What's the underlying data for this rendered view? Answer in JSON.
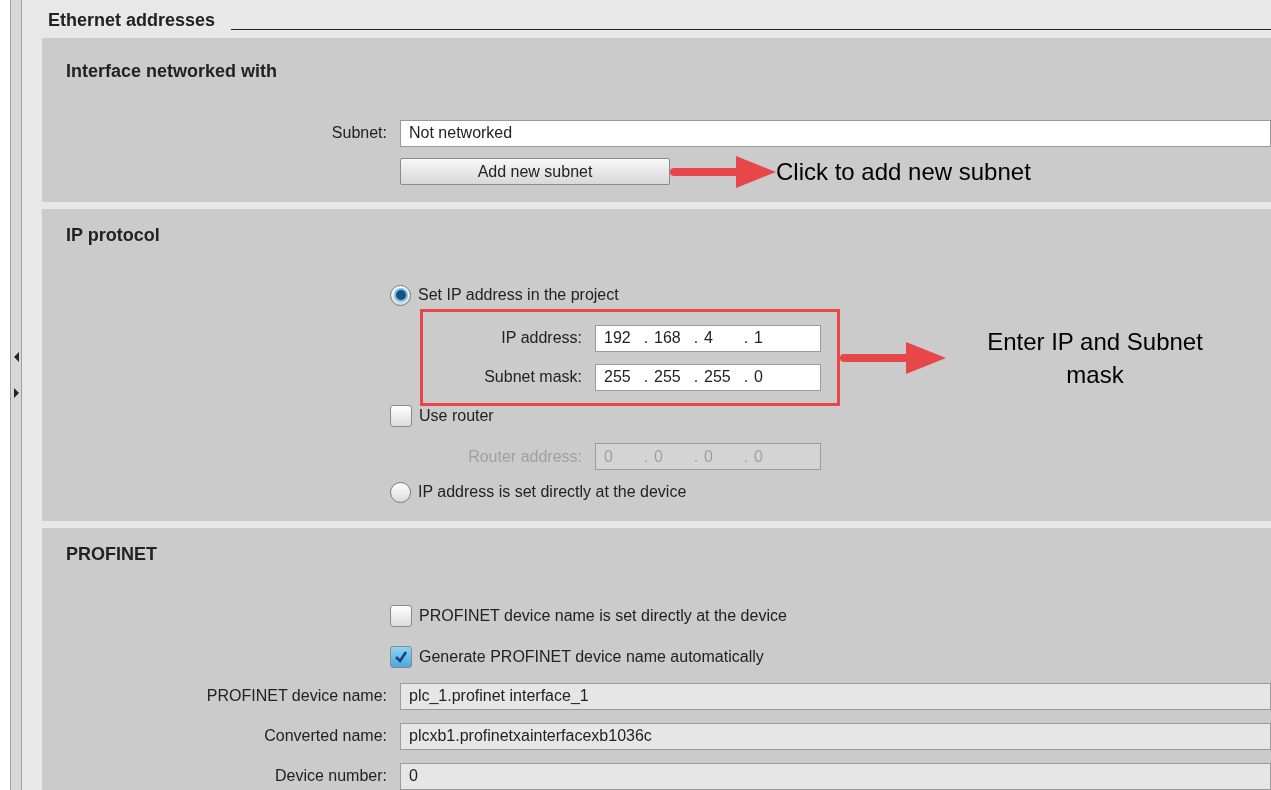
{
  "heading": "Ethernet addresses",
  "interface_section": {
    "title": "Interface networked with",
    "subnet_label": "Subnet:",
    "subnet_value": "Not networked",
    "add_button": "Add new subnet",
    "note": "Click to add new subnet"
  },
  "ip_section": {
    "title": "IP protocol",
    "options": [
      {
        "label": "Set IP address in the project",
        "selected": true
      },
      {
        "label": "IP address is set directly at the device",
        "selected": false
      }
    ],
    "address_fields": [
      {
        "label": "IP address:",
        "octets": [
          "192",
          "168",
          "4",
          "1"
        ],
        "disabled": false
      },
      {
        "label": "Subnet mask:",
        "octets": [
          "255",
          "255",
          "255",
          "0"
        ],
        "disabled": false
      }
    ],
    "separator": ".",
    "use_router": {
      "label": "Use router",
      "checked": false
    },
    "router_field": {
      "label": "Router address:",
      "octets": [
        "0",
        "0",
        "0",
        "0"
      ],
      "disabled": true
    },
    "note": "Enter IP and Subnet mask"
  },
  "profinet_section": {
    "title": "PROFINET",
    "checkboxes": [
      {
        "label": "PROFINET device name is set directly at the device",
        "checked": false
      },
      {
        "label": "Generate PROFINET device name automatically",
        "checked": true
      }
    ],
    "fields": [
      {
        "label": "PROFINET device name:",
        "value": "plc_1.profinet interface_1"
      },
      {
        "label": "Converted name:",
        "value": "plcxb1.profinetxainterfacexb1036c"
      },
      {
        "label": "Device number:",
        "value": "0"
      }
    ]
  }
}
